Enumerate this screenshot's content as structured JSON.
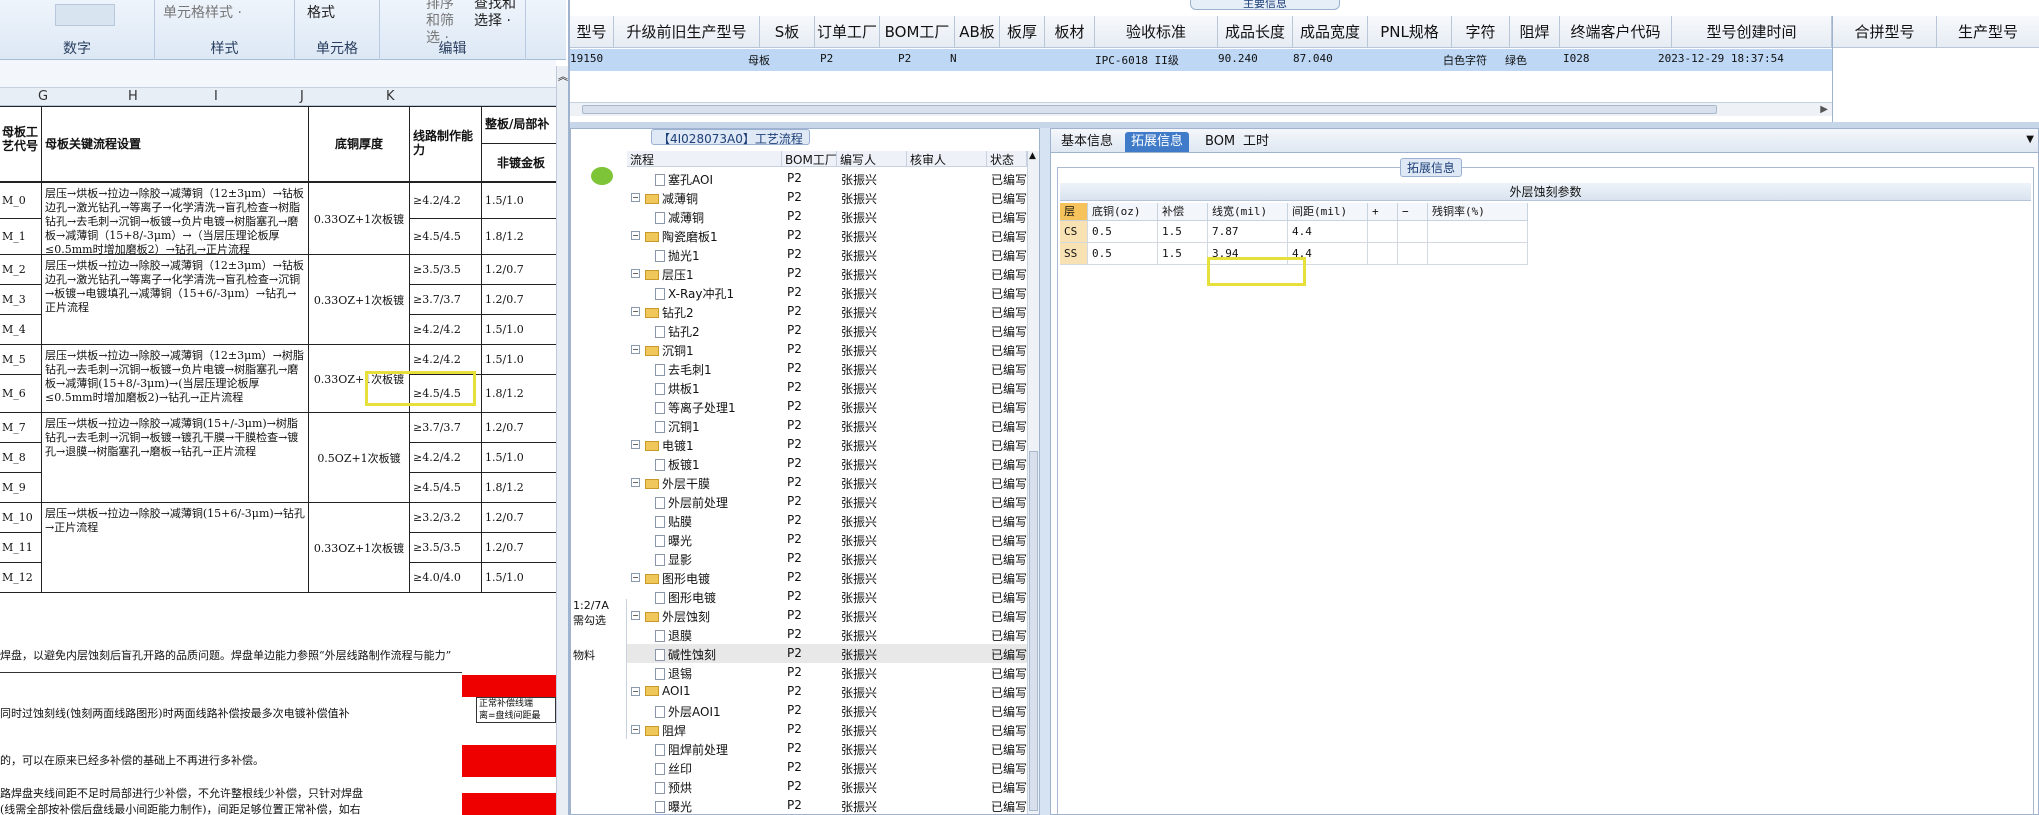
{
  "excel": {
    "ribbon": {
      "groups": [
        {
          "label": "数字"
        },
        {
          "label": "样式",
          "button": "单元格样式 ·"
        },
        {
          "label": "单元格",
          "button": "格式"
        },
        {
          "label": "编辑",
          "button1": "排序和筛选 ·",
          "button2": "查找和选择 ·"
        }
      ]
    },
    "columns": [
      "G",
      "H",
      "I",
      "J",
      "K"
    ],
    "header": {
      "col0": "母板工艺代号",
      "col1": "母板关键流程设置",
      "col2": "底铜厚度",
      "col3": "线路制作能力",
      "col4_top": "整板/局部补",
      "col4_sub": "非镀金板"
    },
    "rows": [
      {
        "code": "M_0",
        "cap": "≥4.2/4.2",
        "comp": "1.5/1.0"
      },
      {
        "code": "M_1",
        "cap": "≥4.5/4.5",
        "comp": "1.8/1.2"
      },
      {
        "code": "M_2",
        "cap": "≥3.5/3.5",
        "comp": "1.2/0.7"
      },
      {
        "code": "M_3",
        "cap": "≥3.7/3.7",
        "comp": "1.2/0.7"
      },
      {
        "code": "M_4",
        "cap": "≥4.2/4.2",
        "comp": "1.5/1.0"
      },
      {
        "code": "M_5",
        "cap": "≥4.2/4.2",
        "comp": "1.5/1.0"
      },
      {
        "code": "M_6",
        "cap": "≥4.5/4.5",
        "comp": "1.8/1.2"
      },
      {
        "code": "M_7",
        "cap": "≥3.7/3.7",
        "comp": "1.2/0.7"
      },
      {
        "code": "M_8",
        "cap": "≥4.2/4.2",
        "comp": "1.5/1.0"
      },
      {
        "code": "M_9",
        "cap": "≥4.5/4.5",
        "comp": "1.8/1.2"
      },
      {
        "code": "M_10",
        "cap": "≥3.2/3.2",
        "comp": "1.2/0.7"
      },
      {
        "code": "M_11",
        "cap": "≥3.5/3.5",
        "comp": "1.2/0.7"
      },
      {
        "code": "M_12",
        "cap": "≥4.0/4.0",
        "comp": "1.5/1.0"
      }
    ],
    "flows": [
      "层压→烘板→拉边→除胶→减薄铜（12±3μm）→钻板边孔→激光钻孔→等离子→化学清洗→盲孔检查→树脂钻孔→去毛刺→沉铜→板镀→负片电镀→树脂塞孔→磨板→减薄铜（15+8/-3μm）→（当层压理论板厚≤0.5mm时增加磨板2）→钻孔→正片流程",
      "层压→烘板→拉边→除胶→减薄铜（12±3μm）→钻板边孔→激光钻孔→等离子→化学清洗→盲孔检查→沉铜→板镀→电镀填孔→减薄铜（15+6/-3μm）→钻孔→正片流程",
      "层压→烘板→拉边→除胶→减薄铜（12±3μm）→树脂钻孔→去毛刺→沉铜→板镀→负片电镀→树脂塞孔→磨板→减薄铜(15+8/-3μm)→(当层压理论板厚≤0.5mm时增加磨板2)→钻孔→正片流程",
      "层压→烘板→拉边→除胶→减薄铜(15+/-3μm)→树脂钻孔→去毛刺→沉铜→板镀→镀孔干膜→干膜检查→镀孔→退膜→树脂塞孔→磨板→钻孔→正片流程",
      "层压→烘板→拉边→除胶→减薄铜(15+6/-3μm)→钻孔→正片流程"
    ],
    "copper": [
      "0.33OZ+1次板镀",
      "0.33OZ+1次板镀",
      "0.33OZ+1次板镀",
      "0.5OZ+1次板镀",
      "0.33OZ+1次板镀"
    ],
    "notes": [
      "焊盘，以避免内层蚀刻后盲孔开路的品质问题。焊盘单边能力参照“外层线路制作流程与能力”",
      "同时过蚀刻线(蚀刻两面线路图形)时两面线路补偿按最多次电镀补偿值补",
      "的，可以在原来已经多补偿的基础上不再进行多补偿。",
      "路焊盘夹线间距不足时局部进行少补偿，不允许整根线少补偿，只针对焊盘",
      "(线需全部按补偿后盘线最小间距能力制作)，间距足够位置正常补偿，如右"
    ],
    "red_img_text": [
      "正常补偿线端",
      "离=盘线间距最"
    ]
  },
  "top": {
    "title": "主要信息",
    "headers": [
      "型号",
      "升级前旧生产型号",
      "S板",
      "订单工厂",
      "BOM工厂",
      "AB板",
      "板厚",
      "板材",
      "验收标准",
      "成品长度",
      "成品宽度",
      "PNL规格",
      "字符",
      "阻焊",
      "终端客户代码",
      "型号创建时间"
    ],
    "row": {
      "model": "19150",
      "sboard": "母板",
      "order_factory": "P2",
      "bom_factory": "P2",
      "ab": "N",
      "standard": "IPC-6018 II级",
      "length": "90.240",
      "width": "87.040",
      "char": "白色字符",
      "mask": "绿色",
      "customer": "I028",
      "created": "2023-12-29 18:37:54"
    },
    "right_headers": [
      "合拼型号",
      "生产型号"
    ]
  },
  "tree": {
    "title": "【4I028073A0】工艺流程",
    "headers": [
      "流程",
      "BOM工厂",
      "编写人",
      "核审人",
      "状态"
    ],
    "left_labels": [
      "1:2/7A",
      "需勾选",
      "物料"
    ],
    "rows": [
      {
        "name": "塞孔AOI",
        "type": "doc",
        "indent": 1,
        "bom": "P2",
        "writer": "张振兴",
        "status": "已编写"
      },
      {
        "name": "减薄铜",
        "type": "folder",
        "indent": 0,
        "bom": "P2",
        "writer": "张振兴",
        "status": "已编写"
      },
      {
        "name": "减薄铜",
        "type": "doc",
        "indent": 1,
        "bom": "P2",
        "writer": "张振兴",
        "status": "已编写"
      },
      {
        "name": "陶瓷磨板1",
        "type": "folder",
        "indent": 0,
        "bom": "P2",
        "writer": "张振兴",
        "status": "已编写"
      },
      {
        "name": "抛光1",
        "type": "doc",
        "indent": 1,
        "bom": "P2",
        "writer": "张振兴",
        "status": "已编写"
      },
      {
        "name": "层压1",
        "type": "folder",
        "indent": 0,
        "bom": "P2",
        "writer": "张振兴",
        "status": "已编写"
      },
      {
        "name": "X-Ray冲孔1",
        "type": "doc",
        "indent": 1,
        "bom": "P2",
        "writer": "张振兴",
        "status": "已编写"
      },
      {
        "name": "钻孔2",
        "type": "folder",
        "indent": 0,
        "bom": "P2",
        "writer": "张振兴",
        "status": "已编写"
      },
      {
        "name": "钻孔2",
        "type": "doc",
        "indent": 1,
        "bom": "P2",
        "writer": "张振兴",
        "status": "已编写"
      },
      {
        "name": "沉铜1",
        "type": "folder",
        "indent": 0,
        "bom": "P2",
        "writer": "张振兴",
        "status": "已编写"
      },
      {
        "name": "去毛刺1",
        "type": "doc",
        "indent": 1,
        "bom": "P2",
        "writer": "张振兴",
        "status": "已编写"
      },
      {
        "name": "烘板1",
        "type": "doc",
        "indent": 1,
        "bom": "P2",
        "writer": "张振兴",
        "status": "已编写"
      },
      {
        "name": "等离子处理1",
        "type": "doc",
        "indent": 1,
        "bom": "P2",
        "writer": "张振兴",
        "status": "已编写"
      },
      {
        "name": "沉铜1",
        "type": "doc",
        "indent": 1,
        "bom": "P2",
        "writer": "张振兴",
        "status": "已编写"
      },
      {
        "name": "电镀1",
        "type": "folder",
        "indent": 0,
        "bom": "P2",
        "writer": "张振兴",
        "status": "已编写"
      },
      {
        "name": "板镀1",
        "type": "doc",
        "indent": 1,
        "bom": "P2",
        "writer": "张振兴",
        "status": "已编写"
      },
      {
        "name": "外层干膜",
        "type": "folder",
        "indent": 0,
        "bom": "P2",
        "writer": "张振兴",
        "status": "已编写"
      },
      {
        "name": "外层前处理",
        "type": "doc",
        "indent": 1,
        "bom": "P2",
        "writer": "张振兴",
        "status": "已编写"
      },
      {
        "name": "贴膜",
        "type": "doc",
        "indent": 1,
        "bom": "P2",
        "writer": "张振兴",
        "status": "已编写"
      },
      {
        "name": "曝光",
        "type": "doc",
        "indent": 1,
        "bom": "P2",
        "writer": "张振兴",
        "status": "已编写"
      },
      {
        "name": "显影",
        "type": "doc",
        "indent": 1,
        "bom": "P2",
        "writer": "张振兴",
        "status": "已编写"
      },
      {
        "name": "图形电镀",
        "type": "folder",
        "indent": 0,
        "bom": "P2",
        "writer": "张振兴",
        "status": "已编写"
      },
      {
        "name": "图形电镀",
        "type": "doc",
        "indent": 1,
        "bom": "P2",
        "writer": "张振兴",
        "status": "已编写"
      },
      {
        "name": "外层蚀刻",
        "type": "folder",
        "indent": 0,
        "bom": "P2",
        "writer": "张振兴",
        "status": "已编写"
      },
      {
        "name": "退膜",
        "type": "doc",
        "indent": 1,
        "bom": "P2",
        "writer": "张振兴",
        "status": "已编写"
      },
      {
        "name": "碱性蚀刻",
        "type": "doc",
        "indent": 1,
        "bom": "P2",
        "writer": "张振兴",
        "status": "已编写",
        "selected": true
      },
      {
        "name": "退锡",
        "type": "doc",
        "indent": 1,
        "bom": "P2",
        "writer": "张振兴",
        "status": "已编写"
      },
      {
        "name": "AOI1",
        "type": "folder",
        "indent": 0,
        "bom": "P2",
        "writer": "张振兴",
        "status": "已编写"
      },
      {
        "name": "外层AOI1",
        "type": "doc",
        "indent": 1,
        "bom": "P2",
        "writer": "张振兴",
        "status": "已编写"
      },
      {
        "name": "阻焊",
        "type": "folder",
        "indent": 0,
        "bom": "P2",
        "writer": "张振兴",
        "status": "已编写"
      },
      {
        "name": "阻焊前处理",
        "type": "doc",
        "indent": 1,
        "bom": "P2",
        "writer": "张振兴",
        "status": "已编写"
      },
      {
        "name": "丝印",
        "type": "doc",
        "indent": 1,
        "bom": "P2",
        "writer": "张振兴",
        "status": "已编写"
      },
      {
        "name": "预烘",
        "type": "doc",
        "indent": 1,
        "bom": "P2",
        "writer": "张振兴",
        "status": "已编写"
      },
      {
        "name": "曝光",
        "type": "doc",
        "indent": 1,
        "bom": "P2",
        "writer": "张振兴",
        "status": "已编写"
      }
    ]
  },
  "detail": {
    "tabs": [
      "基本信息",
      "拓展信息",
      "BOM",
      "工时"
    ],
    "group_title": "拓展信息",
    "sub_title": "外层蚀刻参数",
    "headers": [
      "层",
      "底铜(oz)",
      "补偿",
      "线宽(mil)",
      "间距(mil)",
      "+",
      "−",
      "残铜率(%)"
    ],
    "rows": [
      {
        "layer": "CS",
        "copper": "0.5",
        "comp": "1.5",
        "width": "7.87",
        "space": "4.4",
        "resid": ""
      },
      {
        "layer": "SS",
        "copper": "0.5",
        "comp": "1.5",
        "width": "3.94",
        "space": "4.4",
        "resid": ""
      }
    ]
  }
}
